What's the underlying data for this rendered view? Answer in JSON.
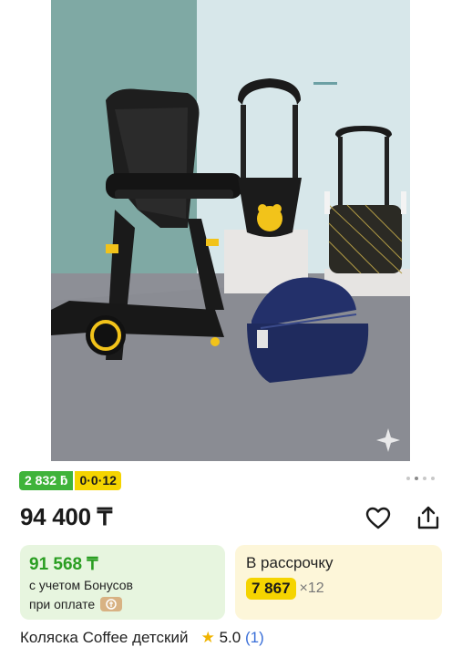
{
  "product": {
    "bonus_badge": "2 832 ƃ",
    "installment_badge": "0·0·12",
    "price": "94 400 ₸",
    "bonus_card": {
      "price": "91 568 ₸",
      "line1": "с учетом Бонусов",
      "line2": "при оплате"
    },
    "installment_card": {
      "title": "В рассрочку",
      "amount": "7 867",
      "multiplier": "×12"
    },
    "title_partial": "Коляска Сoffee детский",
    "rating": "5.0",
    "reviews": "(1)"
  },
  "gallery": {
    "current": 2,
    "total": 4
  },
  "icons": {
    "favorite": "heart-icon",
    "share": "share-icon",
    "sparkle": "sparkle-icon",
    "bonus": "bonus-wallet-icon",
    "star": "star-icon"
  },
  "colors": {
    "bonus_green": "#3fb33a",
    "installment_yellow": "#f5d400",
    "bonus_card_bg": "#e7f5df",
    "installment_card_bg": "#fdf6d9",
    "link_blue": "#3a6fd8"
  }
}
